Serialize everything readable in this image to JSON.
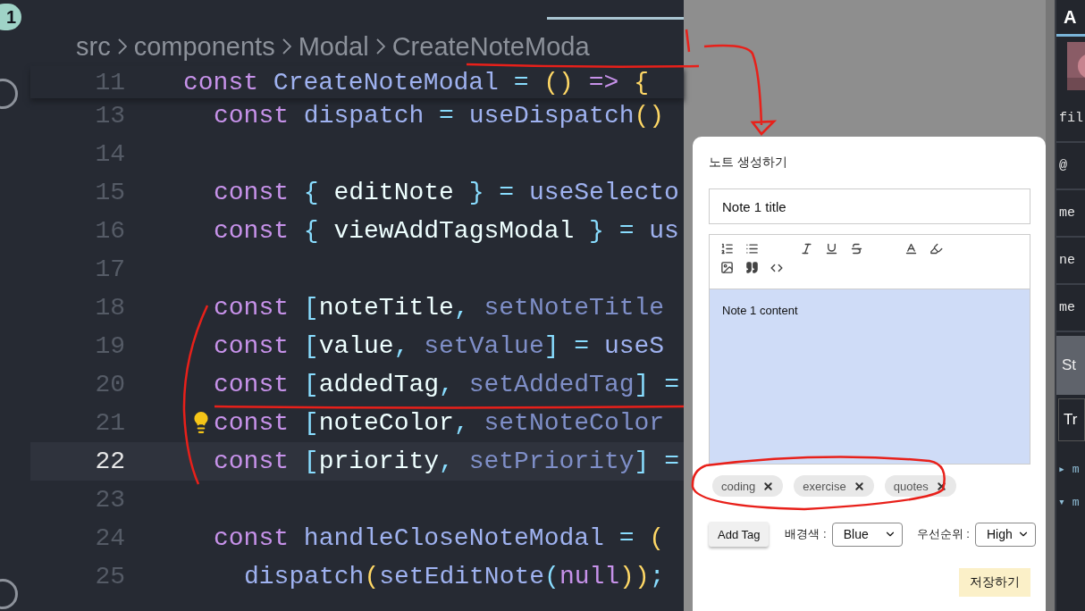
{
  "activity_bar": {
    "badge": "1"
  },
  "breadcrumb": [
    "src",
    "components",
    "Modal",
    "CreateNoteModa"
  ],
  "editor": {
    "lines": [
      {
        "number": "11",
        "kind": "top",
        "current": false,
        "hint": false,
        "tokens": [
          {
            "t": "const ",
            "kind": "kw"
          },
          {
            "t": "CreateNoteModal ",
            "kind": "fn"
          },
          {
            "t": "= ",
            "kind": "op"
          },
          {
            "t": "() ",
            "kind": "br"
          },
          {
            "t": "=> ",
            "kind": "kw"
          },
          {
            "t": "{",
            "kind": "br"
          }
        ]
      },
      {
        "number": "13",
        "kind": "body",
        "current": false,
        "hint": false,
        "tokens": [
          {
            "t": "const ",
            "kind": "kw"
          },
          {
            "t": "dispatch ",
            "kind": "fn"
          },
          {
            "t": "= ",
            "kind": "op"
          },
          {
            "t": "useDispatch",
            "kind": "fn"
          },
          {
            "t": "()",
            "kind": "br"
          }
        ]
      },
      {
        "number": "14",
        "current": false,
        "hint": false
      },
      {
        "number": "15",
        "kind": "body",
        "current": false,
        "hint": false,
        "tokens": [
          {
            "t": "const ",
            "kind": "kw"
          },
          {
            "t": "{ ",
            "kind": "pn"
          },
          {
            "t": "editNote ",
            "kind": "var"
          },
          {
            "t": "} ",
            "kind": "pn"
          },
          {
            "t": "= ",
            "kind": "op"
          },
          {
            "t": "useSelecto",
            "kind": "fn"
          }
        ]
      },
      {
        "number": "16",
        "kind": "body",
        "current": false,
        "hint": false,
        "tokens": [
          {
            "t": "const ",
            "kind": "kw"
          },
          {
            "t": "{ ",
            "kind": "pn"
          },
          {
            "t": "viewAddTagsModal ",
            "kind": "var"
          },
          {
            "t": "} ",
            "kind": "pn"
          },
          {
            "t": "= ",
            "kind": "op"
          },
          {
            "t": "us",
            "kind": "fn"
          }
        ]
      },
      {
        "number": "17",
        "current": false,
        "hint": false
      },
      {
        "number": "18",
        "kind": "body",
        "current": false,
        "hint": false,
        "tokens": [
          {
            "t": "const ",
            "kind": "kw"
          },
          {
            "t": "[",
            "kind": "pn"
          },
          {
            "t": "noteTitle",
            "kind": "var"
          },
          {
            "t": ", ",
            "kind": "pn"
          },
          {
            "t": "setNoteTitle",
            "kind": "dim"
          }
        ]
      },
      {
        "number": "19",
        "kind": "body",
        "current": false,
        "hint": false,
        "tokens": [
          {
            "t": "const ",
            "kind": "kw"
          },
          {
            "t": "[",
            "kind": "pn"
          },
          {
            "t": "value",
            "kind": "var"
          },
          {
            "t": ", ",
            "kind": "pn"
          },
          {
            "t": "setValue",
            "kind": "dim"
          },
          {
            "t": "] ",
            "kind": "pn"
          },
          {
            "t": "= ",
            "kind": "op"
          },
          {
            "t": "useS",
            "kind": "fn"
          }
        ]
      },
      {
        "number": "20",
        "kind": "body",
        "current": false,
        "hint": false,
        "tokens": [
          {
            "t": "const ",
            "kind": "kw"
          },
          {
            "t": "[",
            "kind": "pn"
          },
          {
            "t": "addedTag",
            "kind": "var"
          },
          {
            "t": ", ",
            "kind": "pn"
          },
          {
            "t": "setAddedTag",
            "kind": "dim"
          },
          {
            "t": "] ",
            "kind": "pn"
          },
          {
            "t": "=",
            "kind": "op"
          }
        ]
      },
      {
        "number": "21",
        "kind": "body",
        "current": false,
        "hint": true,
        "tokens": [
          {
            "t": "const ",
            "kind": "kw"
          },
          {
            "t": "[",
            "kind": "pn"
          },
          {
            "t": "noteColor",
            "kind": "var"
          },
          {
            "t": ", ",
            "kind": "pn"
          },
          {
            "t": "setNoteColor",
            "kind": "dim"
          }
        ]
      },
      {
        "number": "22",
        "kind": "body",
        "current": true,
        "hint": false,
        "tokens": [
          {
            "t": "const ",
            "kind": "kw"
          },
          {
            "t": "[",
            "kind": "pn"
          },
          {
            "t": "priority",
            "kind": "var"
          },
          {
            "t": ", ",
            "kind": "pn"
          },
          {
            "t": "setPriority",
            "kind": "dim"
          },
          {
            "t": "] ",
            "kind": "pn"
          },
          {
            "t": "=",
            "kind": "op"
          }
        ]
      },
      {
        "number": "23",
        "current": false,
        "hint": false
      },
      {
        "number": "24",
        "kind": "body",
        "current": false,
        "hint": false,
        "tokens": [
          {
            "t": "const ",
            "kind": "kw"
          },
          {
            "t": "handleCloseNoteModal ",
            "kind": "fn"
          },
          {
            "t": "= ",
            "kind": "op"
          },
          {
            "t": "(",
            "kind": "br"
          }
        ]
      },
      {
        "number": "25",
        "kind": "nested",
        "current": false,
        "hint": false,
        "tokens": [
          {
            "t": "dispatch",
            "kind": "fn"
          },
          {
            "t": "(",
            "kind": "br"
          },
          {
            "t": "setEditNote",
            "kind": "fn"
          },
          {
            "t": "(",
            "kind": "pn"
          },
          {
            "t": "null",
            "kind": "kw"
          },
          {
            "t": "))",
            "kind": "br"
          },
          {
            "t": ";",
            "kind": "pn"
          }
        ]
      }
    ]
  },
  "modal": {
    "title": "노트 생성하기",
    "title_value": "Note 1 title",
    "content": "Note 1 content",
    "tags": [
      {
        "label": "coding"
      },
      {
        "label": "exercise"
      },
      {
        "label": "quotes"
      }
    ],
    "add_tag_button": "Add Tag",
    "color_label": "배경색 :",
    "color_value": "Blue",
    "priority_label": "우선순위 :",
    "priority_value": "High",
    "save_button": "저장하기"
  },
  "side_panel": {
    "items": [
      {
        "kind": "title",
        "text": "A"
      },
      {
        "kind": "thumb"
      },
      {
        "kind": "row",
        "text": "fil"
      },
      {
        "kind": "row",
        "text": "@"
      },
      {
        "kind": "row",
        "text": "me"
      },
      {
        "kind": "row",
        "text": "ne"
      },
      {
        "kind": "row",
        "text": "me"
      },
      {
        "kind": "button",
        "text": "St"
      },
      {
        "kind": "input",
        "text": "Tr"
      },
      {
        "kind": "tree",
        "arrow": "▸",
        "text": "m"
      },
      {
        "kind": "tree",
        "arrow": "▾",
        "text": "m"
      }
    ]
  }
}
